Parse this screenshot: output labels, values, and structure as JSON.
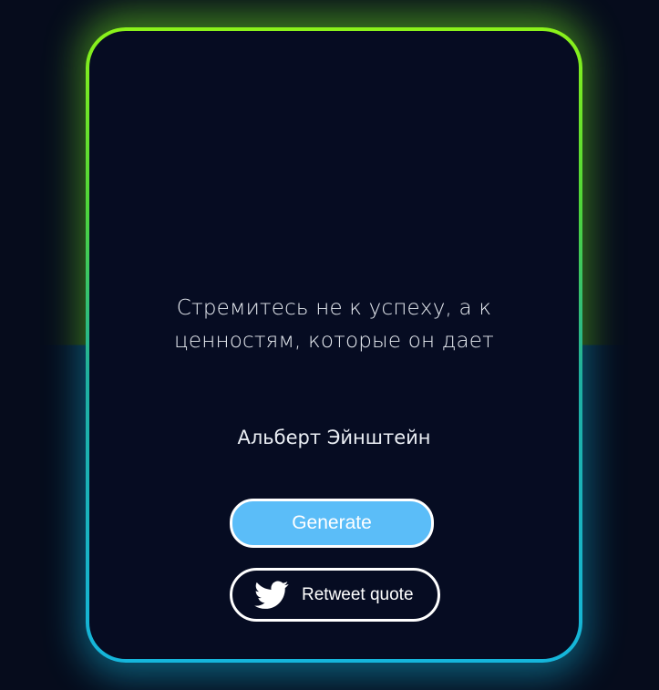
{
  "quote": {
    "text": "Стремитесь не к успеху, а к ценностям, которые он дает",
    "author": "Альберт Эйнштейн"
  },
  "buttons": {
    "generate_label": "Generate",
    "retweet_label": "Retweet quote"
  },
  "icons": {
    "retweet": "twitter-bird-icon"
  },
  "colors": {
    "background": "#060c1c",
    "card": "#060c22",
    "border_top": "#8bf21a",
    "border_bottom": "#15b6dc",
    "generate_button": "#5bbdf8",
    "text": "#e9edf3"
  }
}
